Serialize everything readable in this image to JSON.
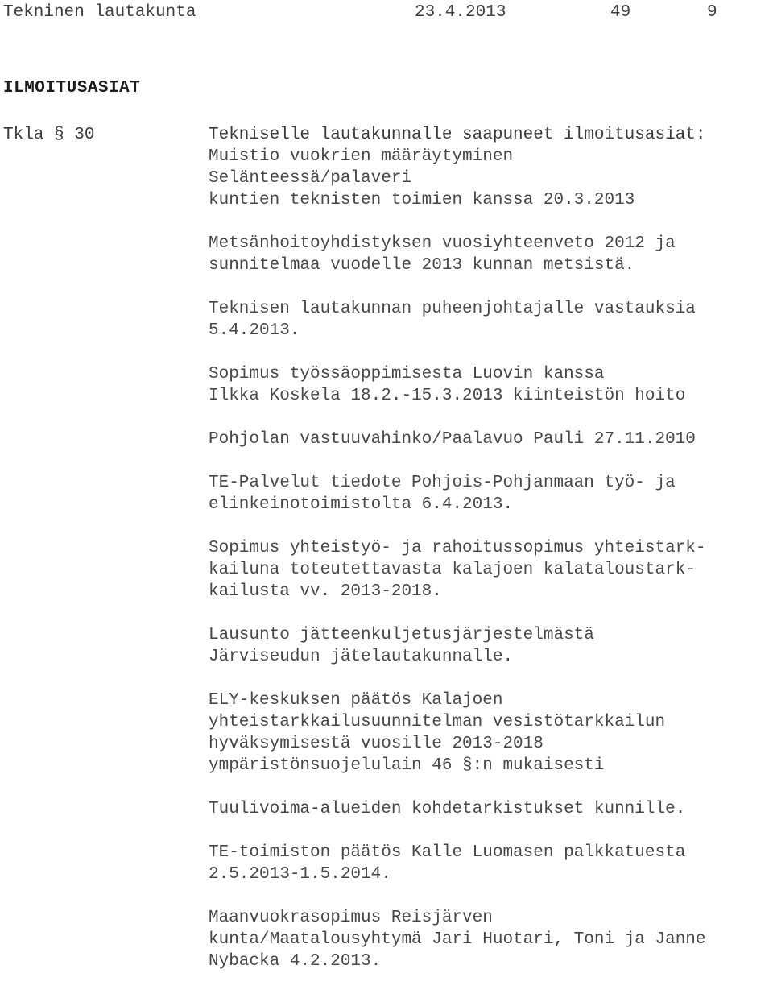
{
  "header": {
    "title": "Tekninen lautakunta",
    "date": "23.4.2013",
    "page_number_left": "49",
    "page_number_right": "9"
  },
  "section": {
    "heading": "ILMOITUSASIAT"
  },
  "item": {
    "pykala_label": "Tkla § 30",
    "lead_text": "Tekniselle lautakunnalle saapuneet ilmoitusasiat:"
  },
  "notices": [
    {
      "lines": [
        "Muistio vuokrien määräytyminen",
        "Selänteessä/palaveri",
        "kuntien teknisten toimien kanssa 20.3.2013"
      ]
    },
    {
      "lines": [
        "Metsänhoitoyhdistyksen vuosiyhteenveto 2012 ja",
        "sunnitelmaa vuodelle 2013 kunnan metsistä."
      ]
    },
    {
      "lines": [
        "Teknisen lautakunnan puheenjohtajalle vastauksia",
        "5.4.2013."
      ]
    },
    {
      "lines": [
        "Sopimus työssäoppimisesta Luovin kanssa",
        "Ilkka Koskela 18.2.-15.3.2013 kiinteistön hoito"
      ]
    },
    {
      "lines": [
        "Pohjolan vastuuvahinko/Paalavuo Pauli 27.11.2010"
      ]
    },
    {
      "lines": [
        "TE-Palvelut tiedote Pohjois-Pohjanmaan työ- ja",
        "elinkeinotoimistolta 6.4.2013."
      ]
    },
    {
      "lines": [
        "Sopimus yhteistyö- ja rahoitussopimus yhteistark-",
        "kailuna toteutettavasta kalajoen kalataloustark-",
        "kailusta vv. 2013-2018."
      ]
    },
    {
      "lines": [
        "Lausunto jätteenkuljetusjärjestelmästä",
        "Järviseudun jätelautakunnalle."
      ]
    },
    {
      "lines": [
        "ELY-keskuksen päätös Kalajoen",
        "yhteistarkkailusuunnitelman vesistötarkkailun",
        "hyväksymisestä vuosille 2013-2018",
        "ympäristönsuojelulain 46 §:n mukaisesti"
      ]
    },
    {
      "lines": [
        "Tuulivoima-alueiden kohdetarkistukset kunnille."
      ]
    },
    {
      "lines": [
        "TE-toimiston päätös Kalle Luomasen palkkatuesta",
        "2.5.2013-1.5.2014."
      ]
    },
    {
      "lines": [
        "Maanvuokrasopimus Reisjärven",
        "kunta/Maatalousyhtymä Jari Huotari, Toni ja Janne",
        "Nybacka 4.2.2013."
      ]
    }
  ]
}
